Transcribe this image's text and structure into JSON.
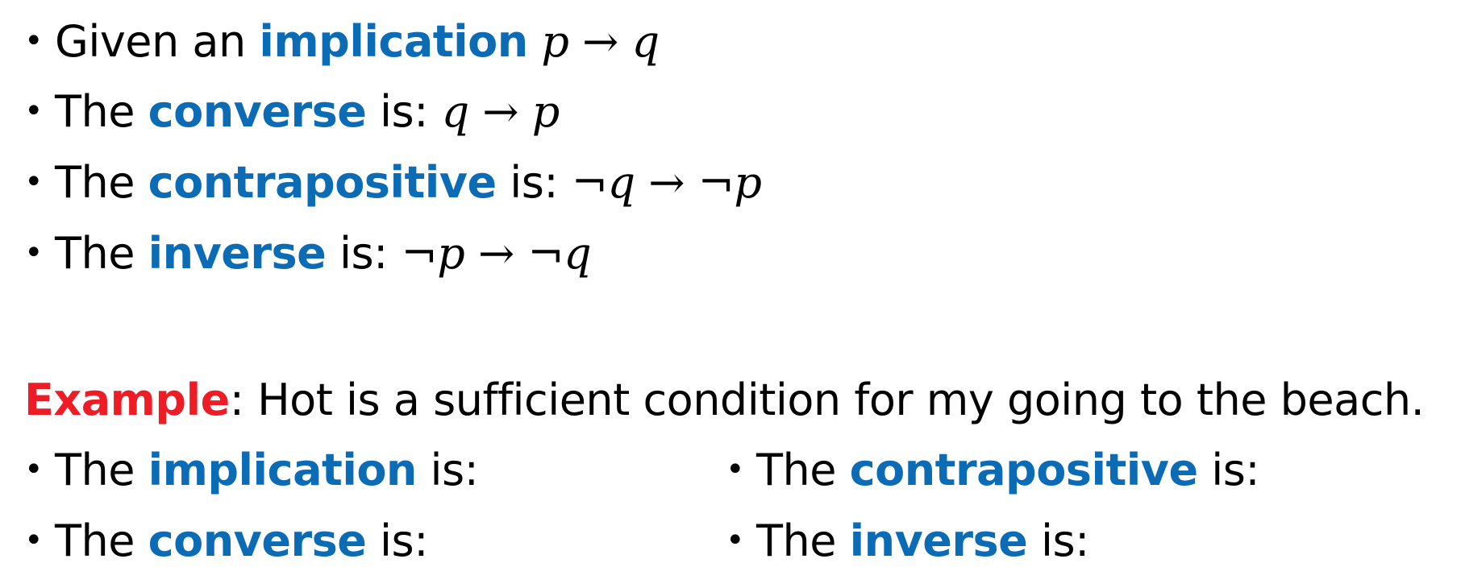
{
  "bullets": [
    {
      "prefix": "Given an ",
      "keyword": "implication",
      "suffix": " ",
      "formula": "p → q"
    },
    {
      "prefix": "The ",
      "keyword": "converse",
      "suffix": " is: ",
      "formula": "q → p"
    },
    {
      "prefix": "The ",
      "keyword": "contrapositive",
      "suffix": " is: ",
      "formula": "¬q → ¬p"
    },
    {
      "prefix": "The ",
      "keyword": "inverse",
      "suffix": " is: ",
      "formula": "¬p → ¬q"
    }
  ],
  "example": {
    "label": "Example",
    "text": ": Hot is a sufficient condition for my going to the beach."
  },
  "exercise_items": [
    {
      "prefix": "The ",
      "keyword": "implication",
      "suffix": " is:"
    },
    {
      "prefix": "The ",
      "keyword": "converse",
      "suffix": " is:"
    },
    {
      "prefix": "The ",
      "keyword": "contrapositive",
      "suffix": " is:"
    },
    {
      "prefix": "The ",
      "keyword": "inverse",
      "suffix": " is:"
    }
  ],
  "bullet_glyph": "•",
  "colors": {
    "keyword": "#0c6bb5",
    "example_label": "#ee1c25",
    "text": "#000000"
  }
}
